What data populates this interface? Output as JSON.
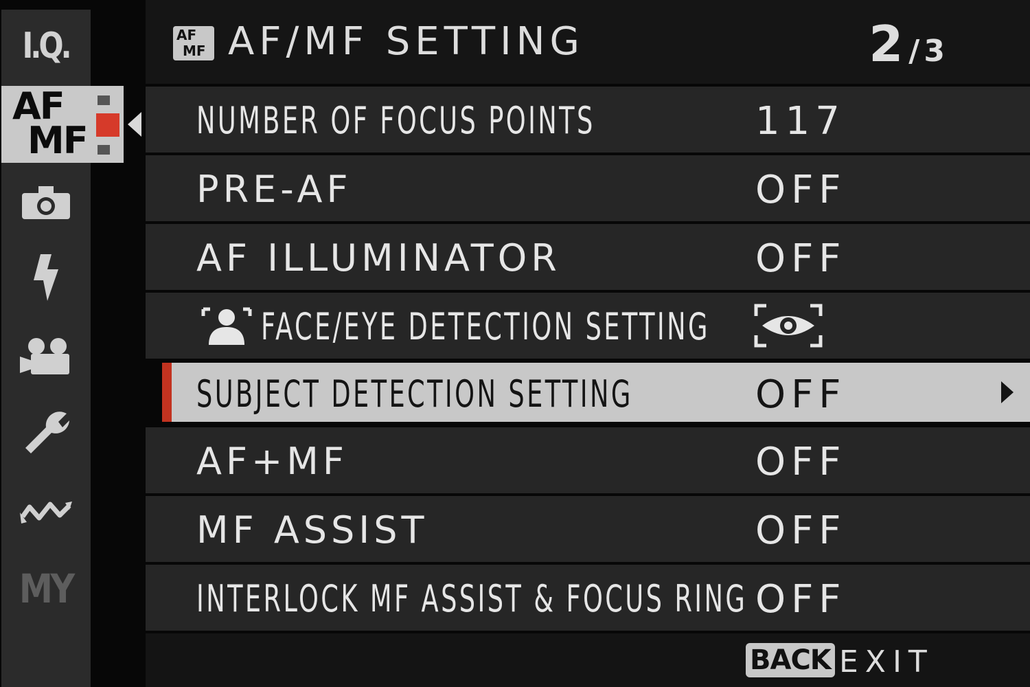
{
  "header": {
    "icon_top": "AF",
    "icon_bottom": "MF",
    "title": "AF/MF SETTING",
    "page_current": "2",
    "page_separator": "/",
    "page_total": "3"
  },
  "sidebar": {
    "items": [
      {
        "id": "iq",
        "label": "I.Q."
      },
      {
        "id": "afmf",
        "label_top": "AF",
        "label_bottom": "MF",
        "active": true
      },
      {
        "id": "shooting",
        "icon": "camera-icon"
      },
      {
        "id": "flash",
        "icon": "flash-icon"
      },
      {
        "id": "movie",
        "icon": "movie-camera-icon"
      },
      {
        "id": "setup",
        "icon": "wrench-icon"
      },
      {
        "id": "connection",
        "icon": "connection-wave-icon"
      },
      {
        "id": "my-menu",
        "label": "MY"
      }
    ],
    "submenu_levels": 3,
    "submenu_selected": 2
  },
  "menu": {
    "rows": [
      {
        "label": "NUMBER OF FOCUS POINTS",
        "value": "117"
      },
      {
        "label": "PRE-AF",
        "value": "OFF"
      },
      {
        "label": "AF ILLUMINATOR",
        "value": "OFF"
      },
      {
        "label": "FACE/EYE DETECTION SETTING",
        "value_icon": "eye-detection-icon",
        "label_icon": "face-detection-icon"
      },
      {
        "label": "SUBJECT DETECTION SETTING",
        "value": "OFF",
        "selected": true
      },
      {
        "label": "AF+MF",
        "value": "OFF"
      },
      {
        "label": "MF ASSIST",
        "value": "OFF"
      },
      {
        "label": "INTERLOCK MF ASSIST & FOCUS RING",
        "value": "OFF"
      }
    ]
  },
  "footer": {
    "back_key": "BACK",
    "exit_label": "EXIT"
  },
  "colors": {
    "accent_red": "#c23320",
    "selected_row_bg": "#c8c8c8",
    "row_bg": "#262626",
    "rail_bg": "#2b2b2b"
  }
}
